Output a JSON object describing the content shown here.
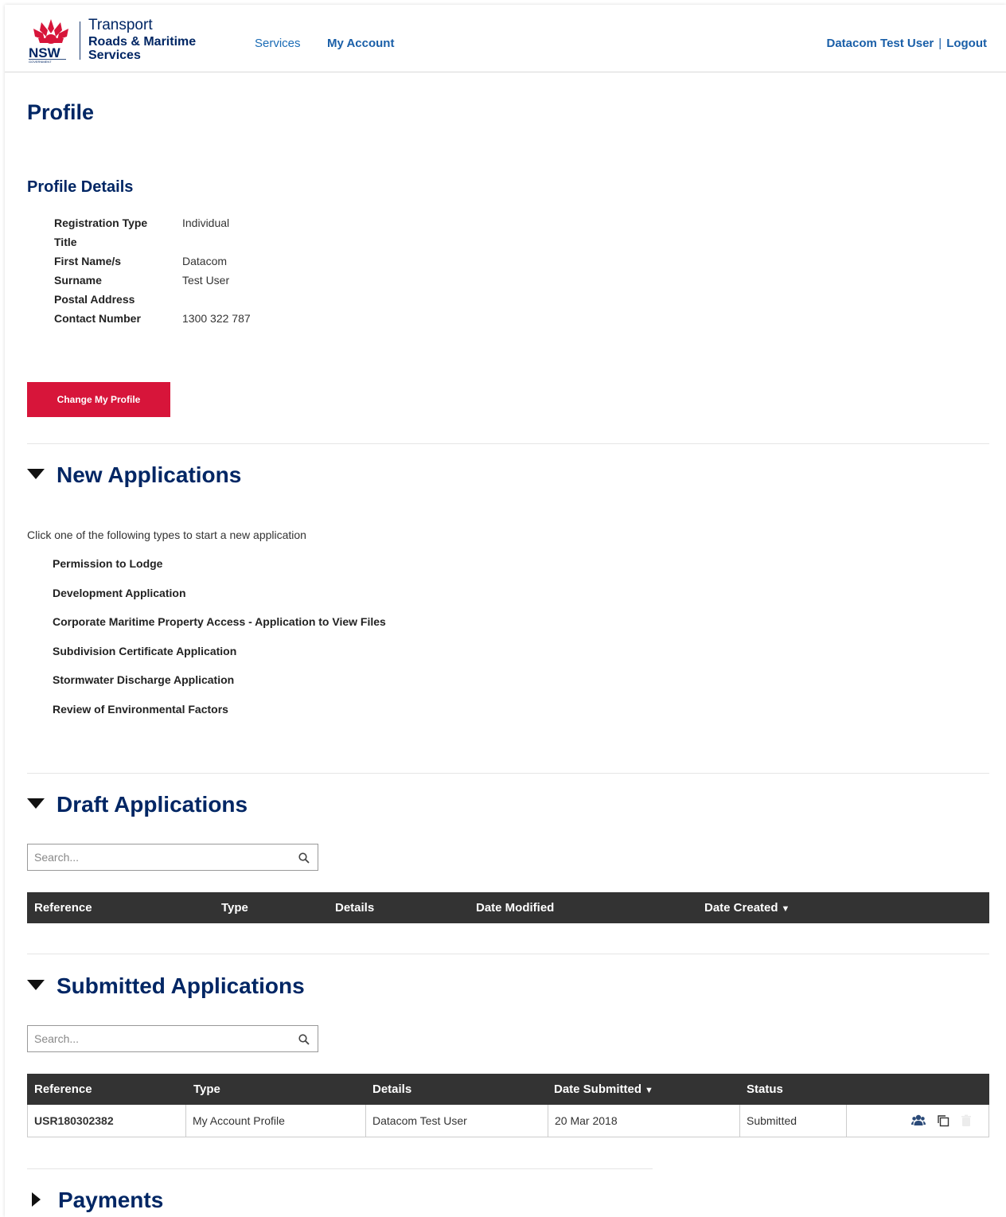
{
  "header": {
    "logo_line1": "Transport",
    "logo_line2": "Roads & Maritime",
    "logo_line3": "Services",
    "logo_nsw": "NSW",
    "logo_gov": "GOVERNMENT",
    "nav_services": "Services",
    "nav_my_account": "My Account",
    "user_name": "Datacom Test User",
    "separator": "|",
    "logout": "Logout"
  },
  "profile": {
    "title": "Profile",
    "details_heading": "Profile Details",
    "fields": [
      {
        "label": "Registration Type",
        "value": "Individual"
      },
      {
        "label": "Title",
        "value": ""
      },
      {
        "label": "First Name/s",
        "value": "Datacom"
      },
      {
        "label": "Surname",
        "value": "Test User"
      },
      {
        "label": "Postal Address",
        "value": ""
      },
      {
        "label": "Contact Number",
        "value": "1300 322 787"
      }
    ],
    "change_button": "Change My Profile"
  },
  "new_applications": {
    "heading": "New Applications",
    "intro": "Click one of the following types to start a new application",
    "types": [
      "Permission to Lodge",
      "Development Application",
      "Corporate Maritime Property Access - Application to View Files",
      "Subdivision Certificate Application",
      "Stormwater Discharge Application",
      "Review of Environmental Factors"
    ]
  },
  "draft_applications": {
    "heading": "Draft Applications",
    "search_placeholder": "Search...",
    "columns": [
      "Reference",
      "Type",
      "Details",
      "Date Modified",
      "Date Created"
    ],
    "sort_indicator": "▼"
  },
  "submitted_applications": {
    "heading": "Submitted Applications",
    "search_placeholder": "Search...",
    "columns": [
      "Reference",
      "Type",
      "Details",
      "Date Submitted",
      "Status"
    ],
    "sort_indicator": "▼",
    "rows": [
      {
        "reference": "USR180302382",
        "type": "My Account Profile",
        "details": "Datacom Test User",
        "date_submitted": "20 Mar 2018",
        "status": "Submitted",
        "actions": [
          "users-icon",
          "copy-icon",
          "trash-icon"
        ]
      }
    ]
  },
  "payments": {
    "heading": "Payments"
  },
  "colors": {
    "brand_navy": "#002664",
    "accent_red": "#d7153a",
    "link_blue": "#1a5fa8",
    "table_header": "#333333"
  }
}
